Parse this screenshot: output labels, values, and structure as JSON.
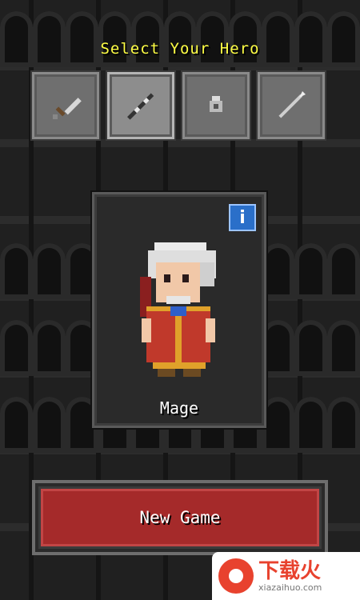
{
  "screen": {
    "title": "Select Your Hero",
    "hero_classes": [
      {
        "name": "warrior",
        "icon": "sword-icon",
        "selected": false
      },
      {
        "name": "mage",
        "icon": "staff-icon",
        "selected": true
      },
      {
        "name": "rogue",
        "icon": "cloak-icon",
        "selected": false
      },
      {
        "name": "huntress",
        "icon": "spear-icon",
        "selected": false
      }
    ],
    "selected_hero": {
      "name": "Mage",
      "info_label": "i"
    },
    "new_game_label": "New Game"
  },
  "watermark": {
    "text_cn": "下载火",
    "url": "xiazaihuo.com"
  },
  "colors": {
    "title": "#ffff44",
    "button_red": "#a52a2a",
    "info_blue": "#2a6fc9"
  }
}
